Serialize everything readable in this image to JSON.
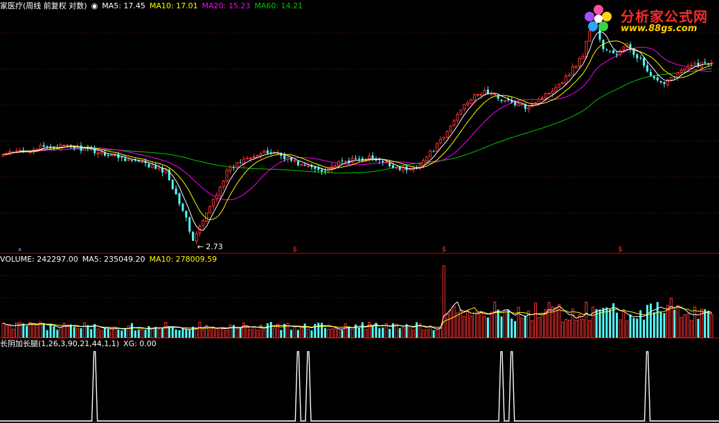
{
  "price_header": {
    "title": "家医疗(周线 前复权 对数)",
    "ma5": "MA5: 17.45",
    "ma10": "MA10: 17.01",
    "ma20": "MA20: 15.23",
    "ma60": "MA60: 14.21"
  },
  "volume_header": {
    "volume": "VOLUME: 242297.00",
    "ma5": "MA5: 235049.20",
    "ma10": "MA10: 278009.59"
  },
  "indicator_header": {
    "name": "长阴加长腿(1,26,3,90,21,44,1,1)",
    "xg": "XG: 0.00"
  },
  "low_label": "← 2.73",
  "signal_marks": [
    "$",
    "$",
    "$",
    "$"
  ],
  "logo": {
    "title": "分析家公式网",
    "url": "www.88gs.com"
  },
  "colors": {
    "up": "#ff3232",
    "down": "#54ffff",
    "ma5": "#ffffff",
    "ma10": "#ffff00",
    "ma20": "#ff00ff",
    "ma60": "#00c800",
    "grid": "#7a0000",
    "separator": "#c80000"
  },
  "chart_data": [
    {
      "type": "candlestick",
      "scale": "log",
      "anchors": [
        [
          0,
          6.7
        ],
        [
          10,
          7.2
        ],
        [
          20,
          7.3
        ],
        [
          30,
          6.8
        ],
        [
          40,
          6.2
        ],
        [
          48,
          5.6
        ],
        [
          53,
          3.8
        ],
        [
          56,
          2.73
        ],
        [
          60,
          3.6
        ],
        [
          66,
          5.6
        ],
        [
          72,
          6.6
        ],
        [
          80,
          6.9
        ],
        [
          88,
          6.0
        ],
        [
          94,
          5.7
        ],
        [
          100,
          6.2
        ],
        [
          108,
          6.5
        ],
        [
          114,
          6.0
        ],
        [
          120,
          5.7
        ],
        [
          124,
          6.3
        ],
        [
          130,
          8.0
        ],
        [
          136,
          11.5
        ],
        [
          142,
          13.0
        ],
        [
          148,
          11.8
        ],
        [
          154,
          11.0
        ],
        [
          160,
          12.5
        ],
        [
          166,
          15.0
        ],
        [
          171,
          19.0
        ],
        [
          174,
          28.0
        ],
        [
          177,
          20.0
        ],
        [
          181,
          19.2
        ],
        [
          184,
          21.0
        ],
        [
          188,
          18.0
        ],
        [
          191,
          15.0
        ],
        [
          194,
          14.0
        ],
        [
          198,
          15.5
        ],
        [
          204,
          17.2
        ],
        [
          209,
          17.45
        ]
      ],
      "low_annotation": 2.73,
      "signal_bars": [
        5,
        86,
        130,
        182
      ]
    },
    {
      "type": "bar",
      "series_name": "VOLUME",
      "last_value": 242297.0,
      "ma5": 235049.2,
      "ma10": 278009.59
    },
    {
      "type": "line",
      "series_name": "XG",
      "last_value": 0.0,
      "spike_bars": [
        27,
        87,
        90,
        147,
        150,
        190
      ]
    }
  ]
}
